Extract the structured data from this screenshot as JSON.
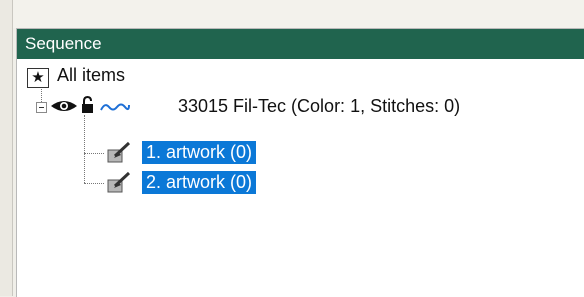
{
  "panel": {
    "title": "Sequence"
  },
  "tree": {
    "all_items": {
      "marker": "★",
      "label": "All items"
    },
    "color_node": {
      "label": "33015 Fil-Tec (Color: 1, Stitches: 0)",
      "icons": [
        "eye-icon",
        "lock-icon",
        "thread-wave-icon"
      ],
      "expanded": true
    },
    "children": [
      {
        "label": "1. artwork (0)",
        "selected": true,
        "icon": "artwork-object-icon"
      },
      {
        "label": "2. artwork (0)",
        "selected": true,
        "icon": "artwork-object-icon"
      }
    ]
  },
  "colors": {
    "titlebar": "#20644e",
    "selection": "#0b78d7",
    "thread_wave": "#1d6fd6"
  }
}
